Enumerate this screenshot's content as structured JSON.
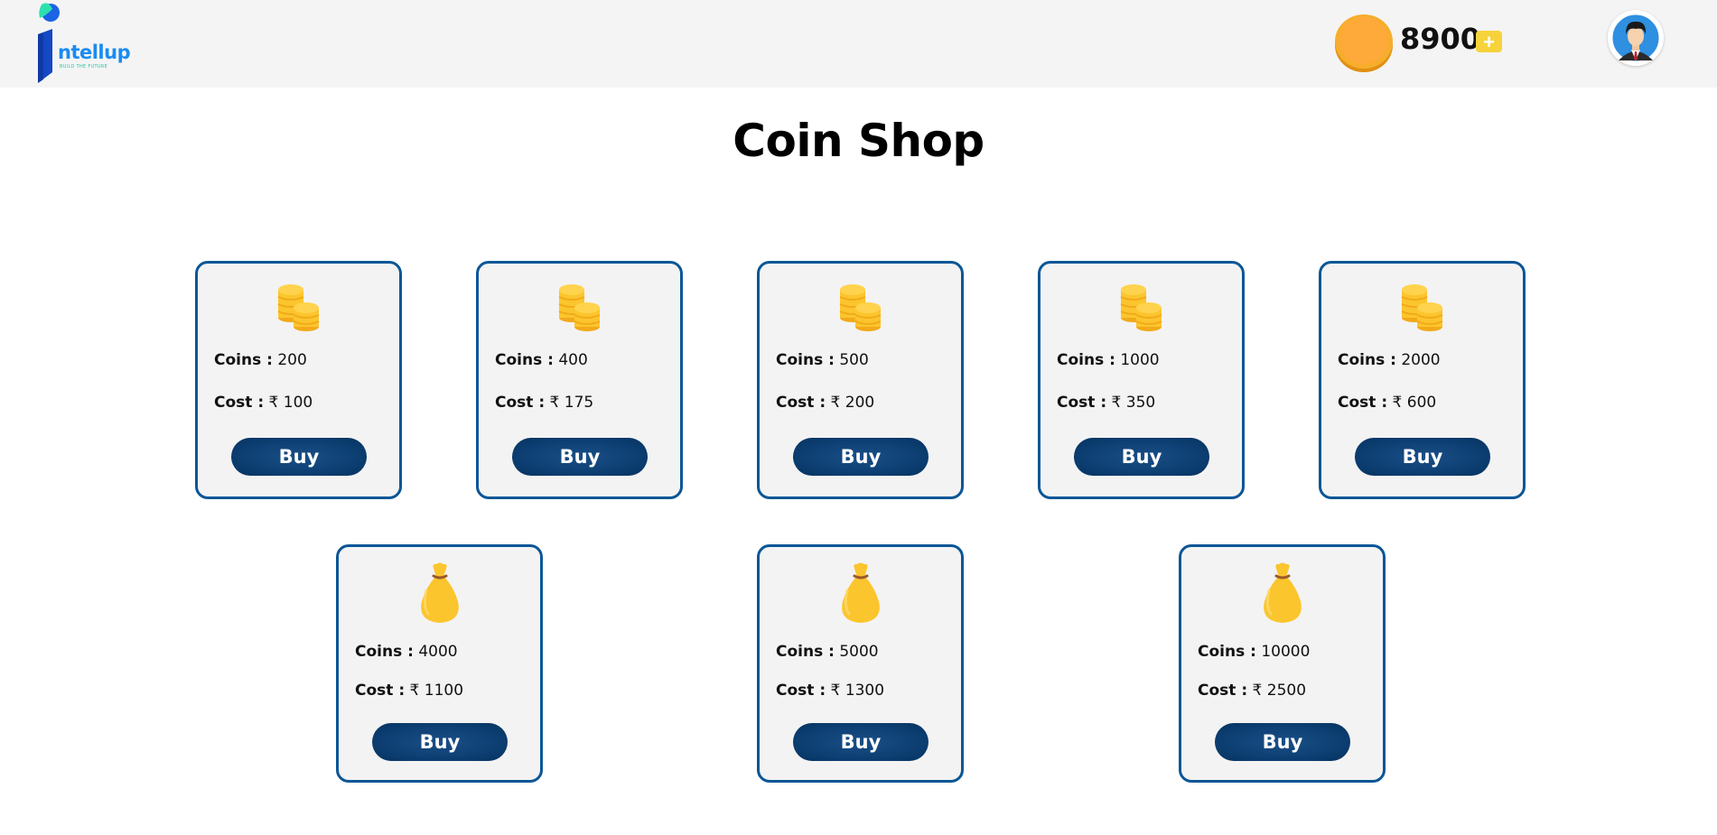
{
  "header": {
    "logo_name": "ntellup",
    "logo_tagline": "BUILD THE FUTURE",
    "coin_balance": "8900",
    "add_label": "+"
  },
  "page_title": "Coin Shop",
  "labels": {
    "coins": "Coins :",
    "cost": "Cost :"
  },
  "buy_label": "Buy",
  "packs": [
    {
      "icon": "coin-stack-icon",
      "coins": "200",
      "cost": "₹ 100"
    },
    {
      "icon": "coin-stack-icon",
      "coins": "400",
      "cost": "₹ 175"
    },
    {
      "icon": "coin-stack-icon",
      "coins": "500",
      "cost": "₹ 200"
    },
    {
      "icon": "coin-stack-icon",
      "coins": "1000",
      "cost": "₹ 350"
    },
    {
      "icon": "coin-stack-icon",
      "coins": "2000",
      "cost": "₹ 600"
    },
    {
      "icon": "money-bag-icon",
      "coins": "4000",
      "cost": "₹ 1100"
    },
    {
      "icon": "money-bag-icon",
      "coins": "5000",
      "cost": "₹ 1300"
    },
    {
      "icon": "money-bag-icon",
      "coins": "10000",
      "cost": "₹ 2500"
    }
  ],
  "colors": {
    "accent": "#0b5696",
    "button": "#0d3f73",
    "coin": "#fbc52d",
    "card_bg": "#f3f3f3",
    "header_bg": "#f4f4f4"
  }
}
